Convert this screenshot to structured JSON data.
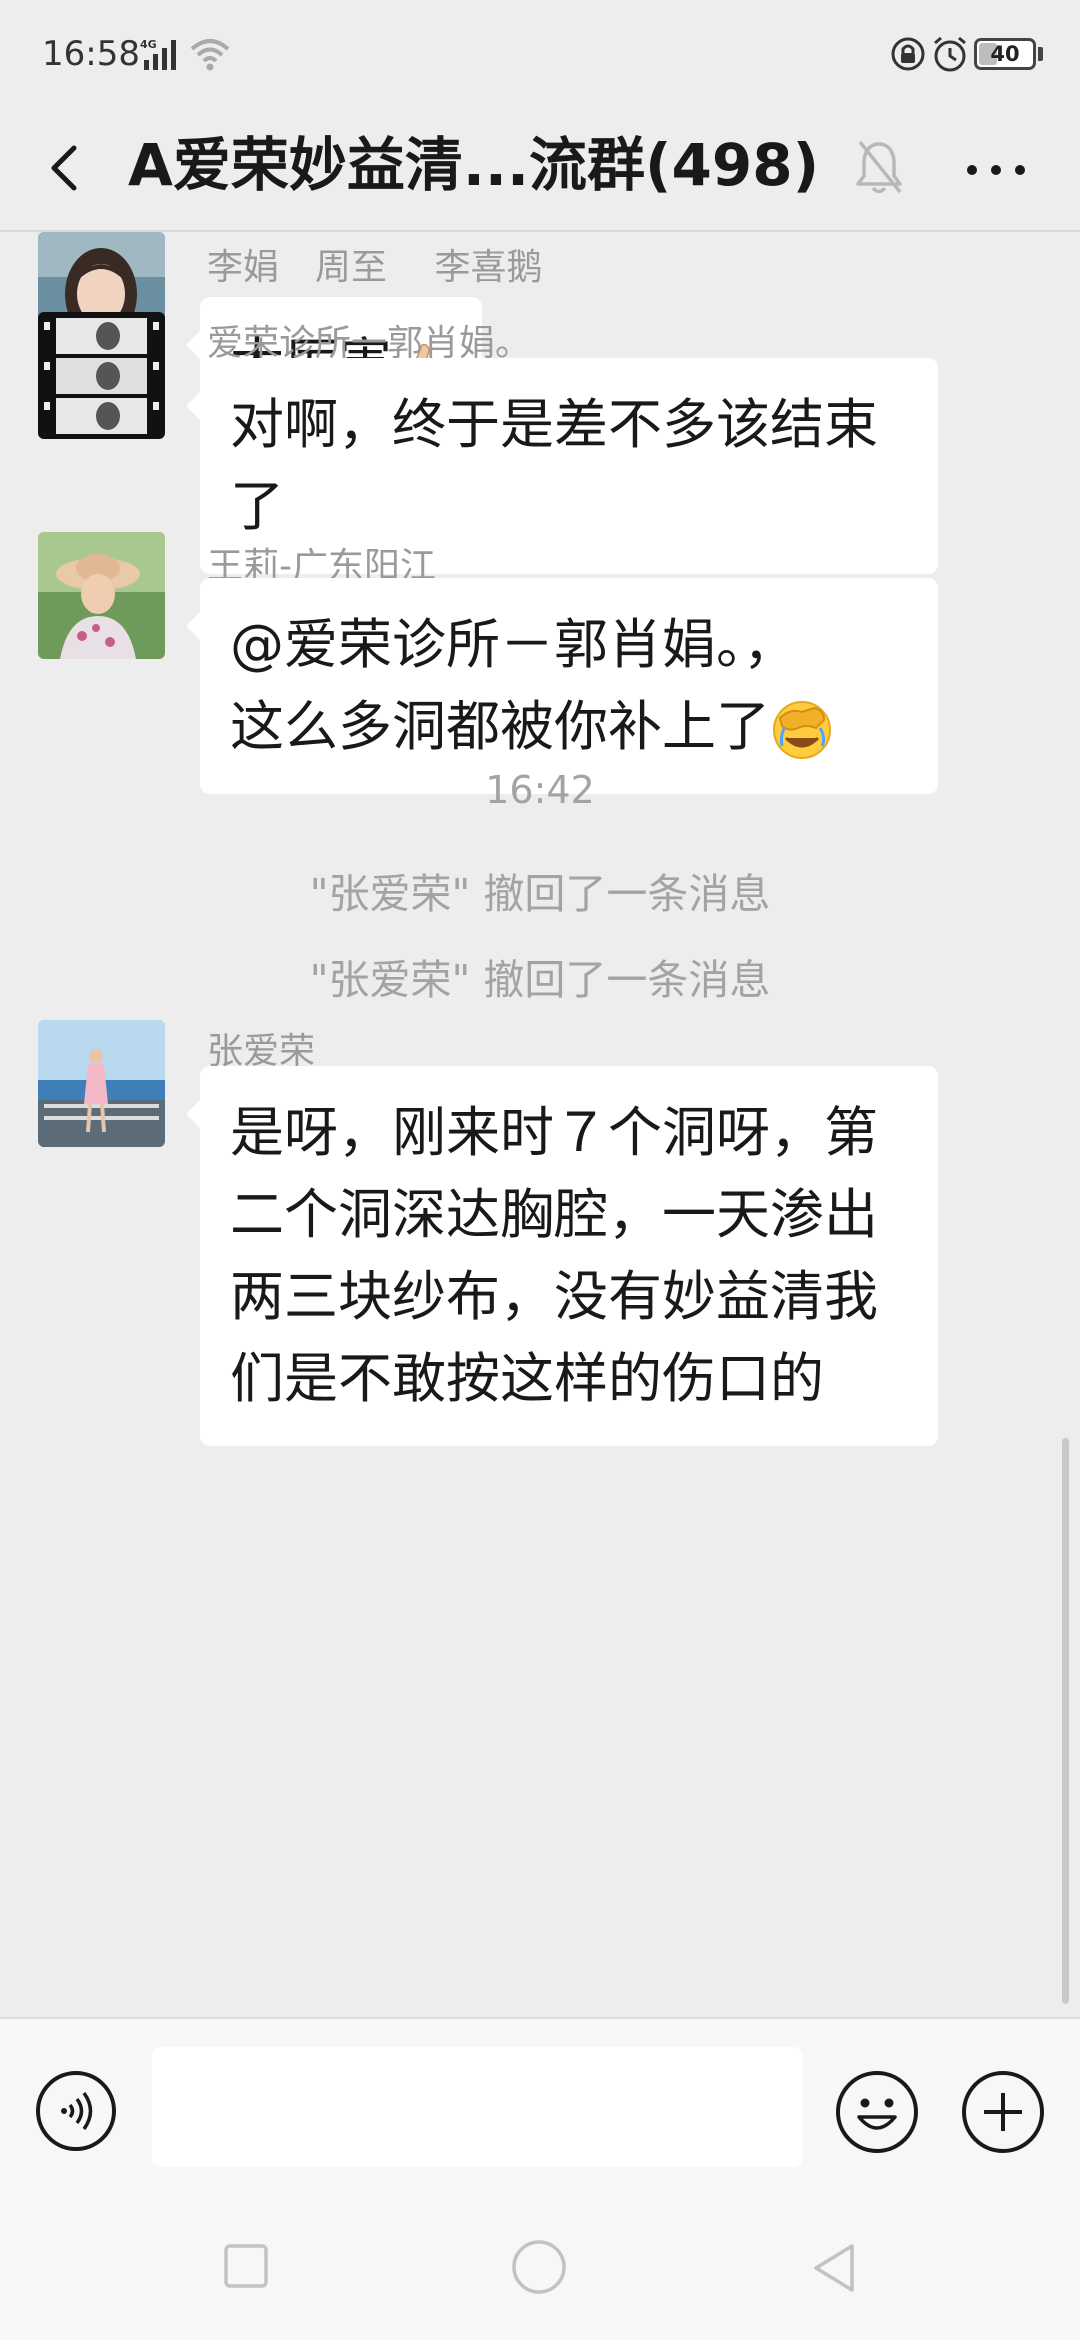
{
  "status_bar": {
    "time": "16:58",
    "network": "4G",
    "battery": "40",
    "battery_level": 0.4
  },
  "title_bar": {
    "title": "A爱荣妙益清...流群(498)"
  },
  "messages": [
    {
      "sender": "李娟　周至　 李喜鹅",
      "lines": [
        "太厉害"
      ],
      "emoji": "thumbs-up"
    },
    {
      "sender": "爱荣诊所一郭肖娟。",
      "lines": [
        "对啊，终于是差不多该结束",
        "了"
      ]
    },
    {
      "sender": "王莉-广东阳江",
      "lines": [
        "@爱荣诊所－郭肖娟。，",
        "这么多洞都被你补上了"
      ],
      "emoji": "face-palm"
    },
    {
      "sender": "张爱荣",
      "lines": [
        "是呀，刚来时７个洞呀，第",
        "二个洞深达胸腔，一天渗出",
        "两三块纱布，没有妙益清我",
        "们是不敢按这样的伤口的"
      ]
    }
  ],
  "time_divider": "16:42",
  "system_notices": [
    "\"张爱荣\" 撤回了一条消息",
    "\"张爱荣\" 撤回了一条消息"
  ],
  "input_bar": {
    "placeholder": ""
  },
  "icons": {
    "back": "back-chevron-icon",
    "mute": "bell-muted-icon",
    "more": "more-dots-icon",
    "voice": "voice-icon",
    "emoji": "emoji-icon",
    "plus": "plus-icon"
  },
  "colors": {
    "background": "#ededed",
    "bubble": "#ffffff",
    "meta_text": "#9a9a9a"
  }
}
